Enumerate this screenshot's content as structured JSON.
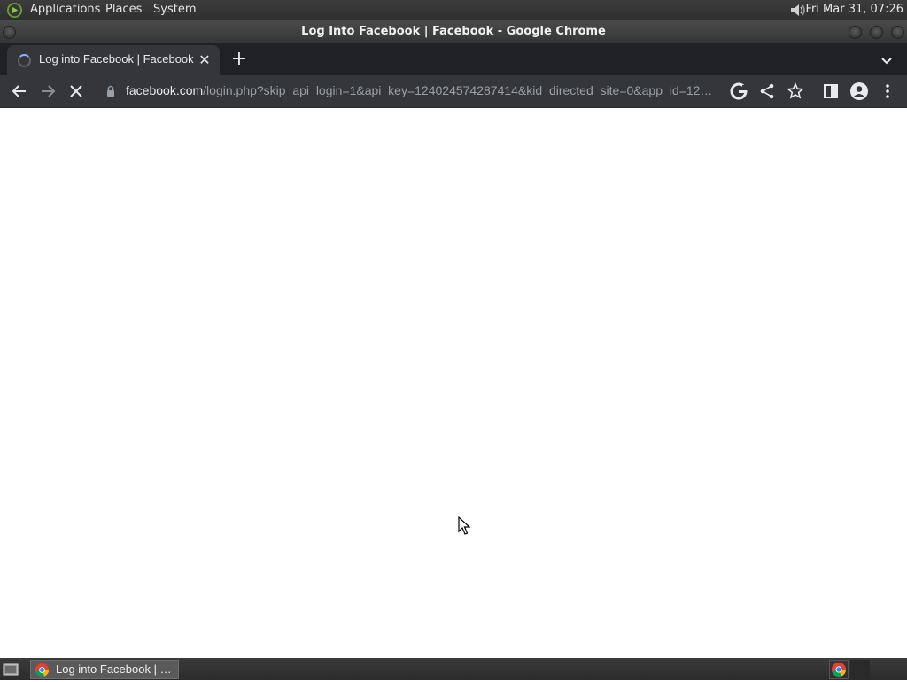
{
  "top_panel": {
    "menus": [
      "Applications",
      "Places",
      "System"
    ],
    "clock": "Fri Mar 31, 07:26"
  },
  "window": {
    "title": "Log Into Facebook | Facebook - Google Chrome"
  },
  "tabs": [
    {
      "title": "Log into Facebook | Facebook",
      "loading": true
    }
  ],
  "omnibox": {
    "host": "facebook.com",
    "path": "/login.php?skip_api_login=1&api_key=124024574287414&kid_directed_site=0&app_id=12…"
  },
  "taskbar": {
    "item_label": "Log into Facebook | …"
  },
  "colors": {
    "chrome_dark": "#202124",
    "toolbar": "#35363a",
    "page_bg": "#ffffff"
  }
}
